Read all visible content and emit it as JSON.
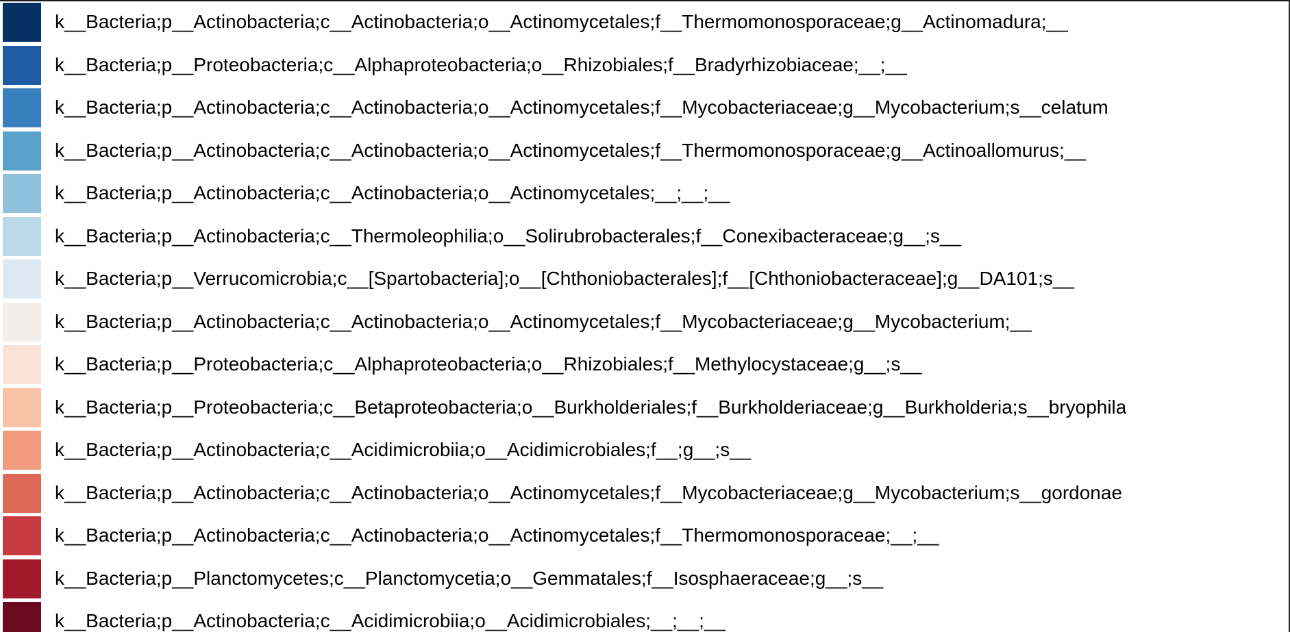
{
  "chart_data": {
    "type": "legend",
    "entries": [
      {
        "label": "k__Bacteria;p__Actinobacteria;c__Actinobacteria;o__Actinomycetales;f__Thermomonosporaceae;g__Actinomadura;__",
        "color": "#053061"
      },
      {
        "label": "k__Bacteria;p__Proteobacteria;c__Alphaproteobacteria;o__Rhizobiales;f__Bradyrhizobiaceae;__;__",
        "color": "#1d5ca3"
      },
      {
        "label": "k__Bacteria;p__Actinobacteria;c__Actinobacteria;o__Actinomycetales;f__Mycobacteriaceae;g__Mycobacterium;s__celatum",
        "color": "#3a7fbd"
      },
      {
        "label": "k__Bacteria;p__Actinobacteria;c__Actinobacteria;o__Actinomycetales;f__Thermomonosporaceae;g__Actinoallomurus;__",
        "color": "#5aa1cb"
      },
      {
        "label": "k__Bacteria;p__Actinobacteria;c__Actinobacteria;o__Actinomycetales;__;__;__",
        "color": "#8fc1dd"
      },
      {
        "label": "k__Bacteria;p__Actinobacteria;c__Thermoleophilia;o__Solirubrobacterales;f__Conexibacteraceae;g__;s__",
        "color": "#bcd9ea"
      },
      {
        "label": "k__Bacteria;p__Verrucomicrobia;c__[Spartobacteria];o__[Chthoniobacterales];f__[Chthoniobacteraceae];g__DA101;s__",
        "color": "#dde9f2"
      },
      {
        "label": "k__Bacteria;p__Actinobacteria;c__Actinobacteria;o__Actinomycetales;f__Mycobacteriaceae;g__Mycobacterium;__",
        "color": "#f2eeec"
      },
      {
        "label": "k__Bacteria;p__Proteobacteria;c__Alphaproteobacteria;o__Rhizobiales;f__Methylocystaceae;g__;s__",
        "color": "#fbe2d6"
      },
      {
        "label": "k__Bacteria;p__Proteobacteria;c__Betaproteobacteria;o__Burkholderiales;f__Burkholderiaceae;g__Burkholderia;s__bryophila",
        "color": "#f9c2a6"
      },
      {
        "label": "k__Bacteria;p__Actinobacteria;c__Acidimicrobiia;o__Acidimicrobiales;f__;g__;s__",
        "color": "#f09b7c"
      },
      {
        "label": "k__Bacteria;p__Actinobacteria;c__Actinobacteria;o__Actinomycetales;f__Mycobacteriaceae;g__Mycobacterium;s__gordonae",
        "color": "#de6957"
      },
      {
        "label": "k__Bacteria;p__Actinobacteria;c__Actinobacteria;o__Actinomycetales;f__Thermomonosporaceae;__;__",
        "color": "#c63a40"
      },
      {
        "label": "k__Bacteria;p__Planctomycetes;c__Planctomycetia;o__Gemmatales;f__Isosphaeraceae;g__;s__",
        "color": "#a01a2c"
      },
      {
        "label": "k__Bacteria;p__Actinobacteria;c__Acidimicrobiia;o__Acidimicrobiales;__;__;__",
        "color": "#6b0a20"
      }
    ]
  }
}
